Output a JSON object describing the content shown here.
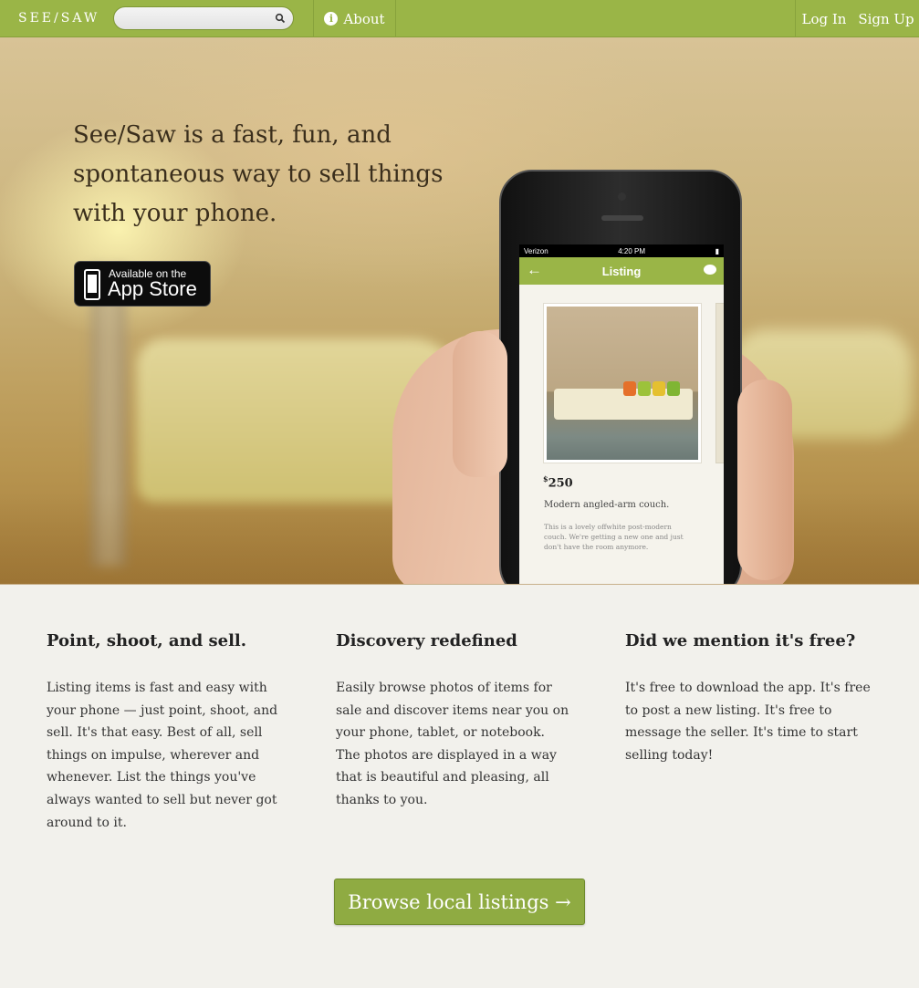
{
  "nav": {
    "brand": "SEE/SAW",
    "search_placeholder": "",
    "about_label": "About",
    "login_label": "Log In",
    "signup_label": "Sign Up",
    "accent_color": "#9ab547"
  },
  "hero": {
    "tagline": "See/Saw is a fast, fun, and spontaneous way to sell things with your phone.",
    "appstore": {
      "small": "Available on the",
      "big": "App Store"
    },
    "phone": {
      "carrier": "Verizon",
      "time": "4:20 PM",
      "screen_title": "Listing",
      "price_symbol": "$",
      "price": "250",
      "item_title": "Modern angled-arm couch.",
      "item_description": "This is a lovely offwhite post-modern couch. We're getting a new one and just don't have the room anymore."
    }
  },
  "features": [
    {
      "title": "Point, shoot, and sell.",
      "body": "Listing items is fast and easy with your phone — just point, shoot, and sell. It's that easy. Best of all, sell things on impulse, wherever and whenever. List the things you've always wanted to sell but never got around to it."
    },
    {
      "title": "Discovery redefined",
      "body": "Easily browse photos of items for sale and discover items near you on your phone, tablet, or notebook. The photos are displayed in a way that is beautiful and pleasing, all thanks to you."
    },
    {
      "title": "Did we mention it's free?",
      "body": "It's free to download the app. It's free to post a new listing. It's free to message the seller. It's time to start selling today!"
    }
  ],
  "cta": {
    "browse_label": "Browse local listings →"
  }
}
